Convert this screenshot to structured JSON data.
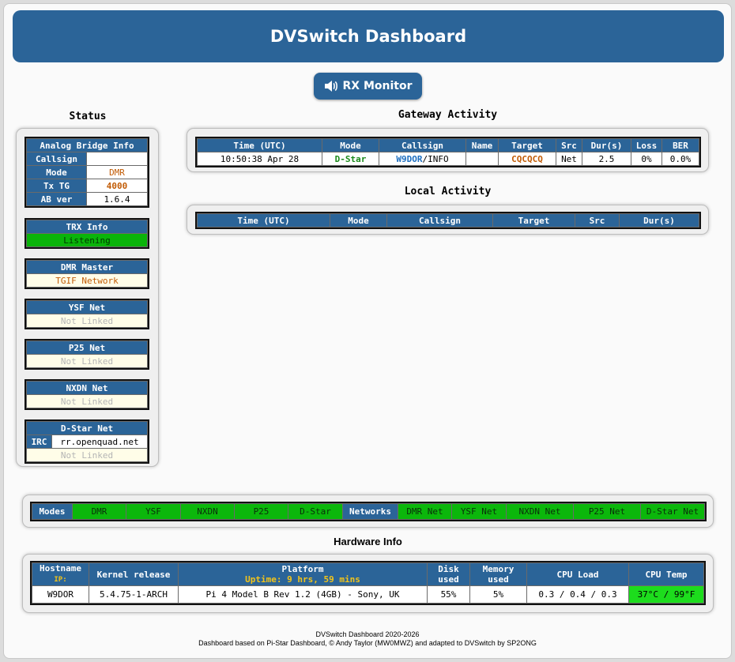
{
  "header": {
    "title": "DVSwitch Dashboard"
  },
  "rx_monitor": {
    "label": "RX Monitor"
  },
  "status": {
    "title": "Status",
    "analog_bridge": {
      "title": "Analog Bridge Info",
      "rows": [
        {
          "label": "Callsign",
          "value": ""
        },
        {
          "label": "Mode",
          "value": "DMR"
        },
        {
          "label": "Tx TG",
          "value": "4000"
        },
        {
          "label": "AB ver",
          "value": "1.6.4"
        }
      ]
    },
    "trx": {
      "title": "TRX Info",
      "value": "Listening"
    },
    "dmr_master": {
      "title": "DMR Master",
      "value": "TGIF Network"
    },
    "ysf": {
      "title": "YSF Net",
      "value": "Not Linked"
    },
    "p25": {
      "title": "P25 Net",
      "value": "Not Linked"
    },
    "nxdn": {
      "title": "NXDN Net",
      "value": "Not Linked"
    },
    "dstar": {
      "title": "D-Star Net",
      "irc_label": "IRC",
      "irc_value": "rr.openquad.net",
      "value": "Not Linked"
    }
  },
  "gateway": {
    "title": "Gateway Activity",
    "columns": [
      "Time (UTC)",
      "Mode",
      "Callsign",
      "Name",
      "Target",
      "Src",
      "Dur(s)",
      "Loss",
      "BER"
    ],
    "rows": [
      {
        "time": "10:50:38 Apr 28",
        "mode": "D-Star",
        "callsign": "W9DOR",
        "callsign_suffix": "/INFO",
        "name": "",
        "target": "CQCQCQ",
        "src": "Net",
        "dur": "2.5",
        "loss": "0%",
        "ber": "0.0%"
      }
    ]
  },
  "local": {
    "title": "Local Activity",
    "columns": [
      "Time (UTC)",
      "Mode",
      "Callsign",
      "Target",
      "Src",
      "Dur(s)"
    ]
  },
  "modes_bar": {
    "modes_label": "Modes",
    "modes": [
      "DMR",
      "YSF",
      "NXDN",
      "P25",
      "D-Star"
    ],
    "networks_label": "Networks",
    "networks": [
      "DMR Net",
      "YSF Net",
      "NXDN Net",
      "P25 Net",
      "D-Star Net"
    ]
  },
  "hardware": {
    "title": "Hardware Info",
    "headers": {
      "hostname": "Hostname",
      "ip": "IP:",
      "kernel": "Kernel release",
      "platform": "Platform",
      "uptime": "Uptime: 9 hrs, 59 mins",
      "disk": "Disk used",
      "memory": "Memory used",
      "cpu_load": "CPU Load",
      "cpu_temp": "CPU Temp"
    },
    "values": {
      "hostname": "W9DOR",
      "kernel": "5.4.75-1-ARCH",
      "platform": "Pi 4 Model B Rev 1.2 (4GB) - Sony, UK",
      "disk": "55%",
      "memory": "5%",
      "cpu_load": "0.3 / 0.4 / 0.3",
      "cpu_temp": "37°C / 99°F"
    }
  },
  "footer": {
    "line1": "DVSwitch Dashboard 2020-2026",
    "line2": "Dashboard based on Pi-Star Dashboard, © Andy Taylor (MW0MWZ) and adapted to DVSwitch by SP2ONG"
  },
  "colors": {
    "accent": "#2b6498",
    "active": "#0bb70b",
    "temp": "#1ddc1d",
    "uptime": "#f3c419"
  },
  "icons": {
    "rx_monitor": "speaker-icon"
  }
}
